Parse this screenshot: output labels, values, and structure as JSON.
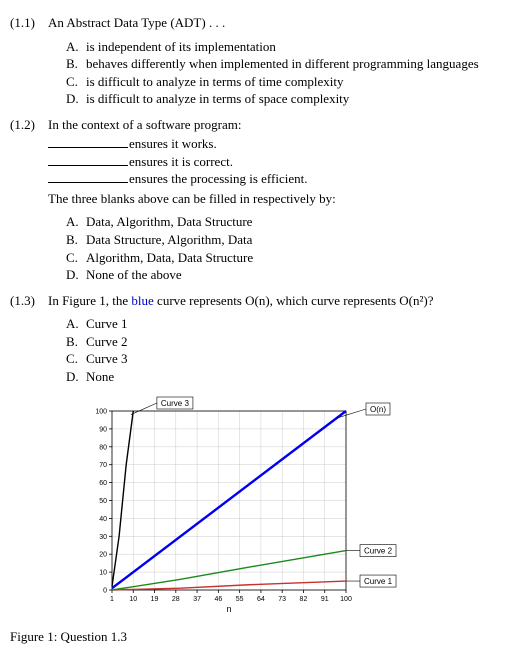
{
  "q1": {
    "num": "(1.1)",
    "text": "An Abstract Data Type (ADT) . . .",
    "opts": {
      "A": "is independent of its implementation",
      "B": "behaves differently when implemented in different programming languages",
      "C": "is difficult to analyze in terms of time complexity",
      "D": "is difficult to analyze in terms of space complexity"
    }
  },
  "q2": {
    "num": "(1.2)",
    "text": "In the context of a software program:",
    "fills": {
      "a": "ensures it works.",
      "b": "ensures it is correct.",
      "c": "ensures the processing is efficient."
    },
    "after": "The three blanks above can be filled in respectively by:",
    "opts": {
      "A": "Data, Algorithm, Data Structure",
      "B": "Data Structure, Algorithm, Data",
      "C": "Algorithm, Data, Data Structure",
      "D": "None of the above"
    }
  },
  "q3": {
    "num": "(1.3)",
    "before_blue": "In Figure 1, the ",
    "blue": "blue",
    "after_blue": " curve represents O(n), which curve represents O(n²)?",
    "opts": {
      "A": "Curve 1",
      "B": "Curve 2",
      "C": "Curve 3",
      "D": "None"
    }
  },
  "caption": "Figure 1: Question 1.3",
  "chart_data": {
    "type": "line",
    "xlabel": "n",
    "ylabel": "",
    "xlim": [
      1,
      100
    ],
    "ylim": [
      0,
      100
    ],
    "x_ticks": [
      1,
      10,
      19,
      28,
      37,
      46,
      55,
      64,
      73,
      82,
      91,
      100
    ],
    "y_ticks": [
      0,
      10,
      20,
      30,
      40,
      50,
      60,
      70,
      80,
      90,
      100
    ],
    "series": [
      {
        "name": "Curve 1",
        "color": "#c93030",
        "points": [
          [
            1,
            0
          ],
          [
            30,
            1
          ],
          [
            60,
            3
          ],
          [
            100,
            5
          ]
        ]
      },
      {
        "name": "Curve 2",
        "color": "#1a8a1a",
        "points": [
          [
            1,
            0
          ],
          [
            30,
            6
          ],
          [
            60,
            13
          ],
          [
            100,
            22
          ]
        ]
      },
      {
        "name": "O(n)",
        "color": "#0000ee",
        "points": [
          [
            1,
            1
          ],
          [
            100,
            100
          ]
        ]
      },
      {
        "name": "Curve 3",
        "color": "#000000",
        "points": [
          [
            1,
            2
          ],
          [
            4,
            30
          ],
          [
            7,
            70
          ],
          [
            10,
            100
          ]
        ]
      }
    ],
    "labels": {
      "curve3": "Curve 3",
      "on": "O(n)",
      "curve2": "Curve 2",
      "curve1": "Curve 1"
    }
  }
}
